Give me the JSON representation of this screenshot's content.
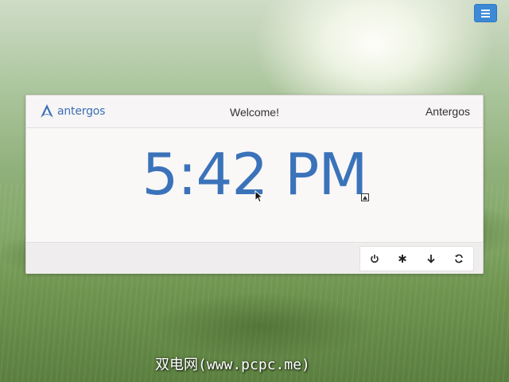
{
  "top_bar": {
    "menu_icon": "hamburger-menu-icon",
    "menu_color": "#3c8ad6"
  },
  "panel": {
    "logo_text": "antergos",
    "welcome": "Welcome!",
    "hostname": "Antergos",
    "clock": "5:42 PM",
    "accent_color": "#3b73ba",
    "actions": [
      {
        "icon": "power-icon",
        "label": "Shutdown"
      },
      {
        "icon": "asterisk-icon",
        "label": "Restart"
      },
      {
        "icon": "arrow-down-icon",
        "label": "Suspend"
      },
      {
        "icon": "refresh-icon",
        "label": "Hibernate"
      }
    ]
  },
  "watermark": "双电网(www.pcpc.me)"
}
